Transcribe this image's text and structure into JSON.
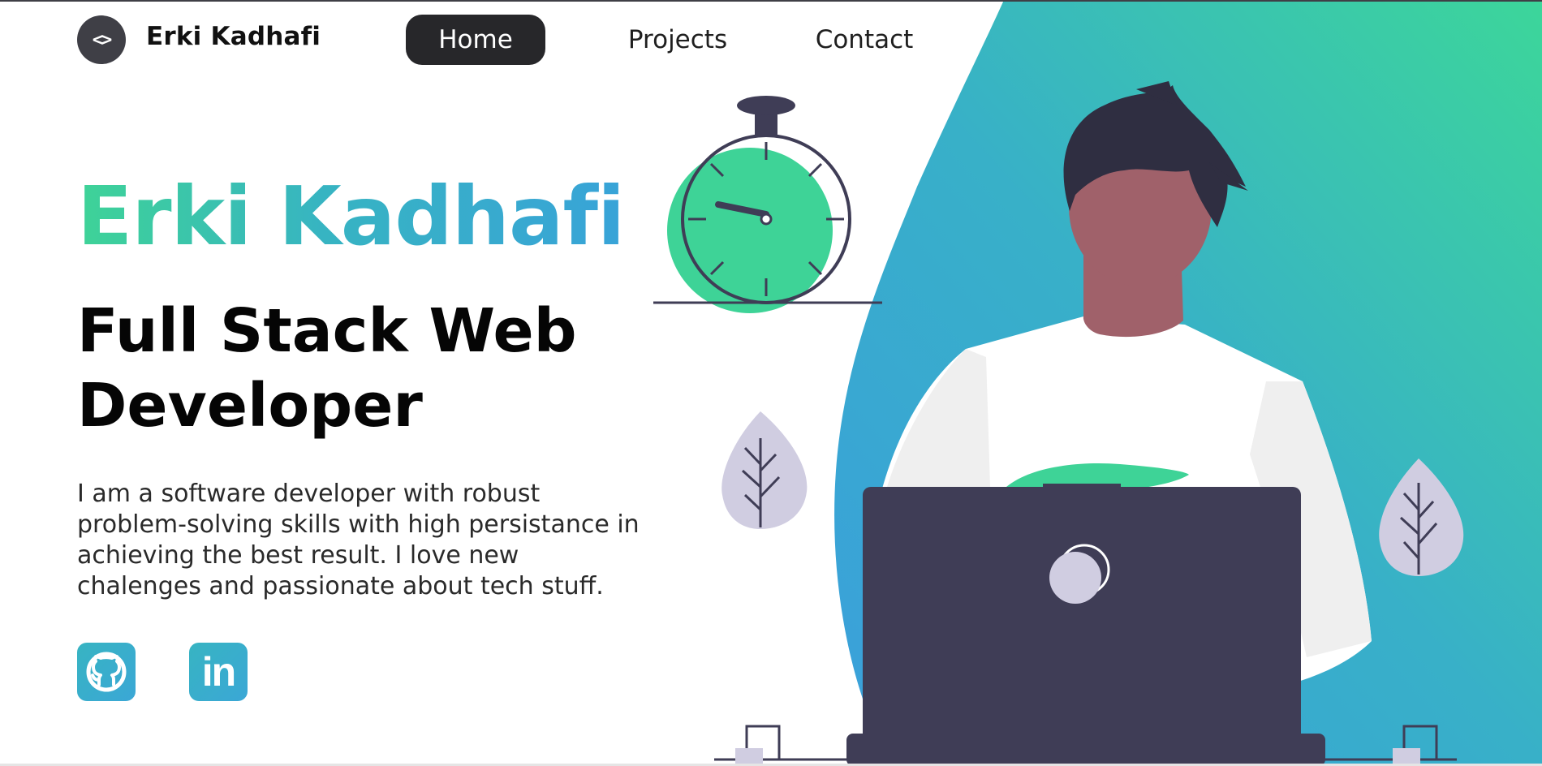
{
  "nav": {
    "logo_glyph": "<>",
    "brand": "Erki Kadhafi",
    "links": [
      {
        "label": "Home",
        "active": true
      },
      {
        "label": "Projects",
        "active": false
      },
      {
        "label": "Contact",
        "active": false
      }
    ]
  },
  "hero": {
    "name": "Erki Kadhafi",
    "title": "Full Stack Web Developer",
    "description": "I am a software developer with robust problem-solving skills with high persistance in achieving the best result. I love new chalenges and passionate about tech stuff."
  },
  "social": [
    {
      "name": "github",
      "icon": "github-icon"
    },
    {
      "name": "linkedin",
      "icon": "linkedin-icon",
      "glyph": "in"
    }
  ],
  "colors": {
    "accent_green": "#3ed397",
    "accent_blue": "#38a3d8",
    "dark": "#3f3d56",
    "nav_active_bg": "#27272a"
  }
}
